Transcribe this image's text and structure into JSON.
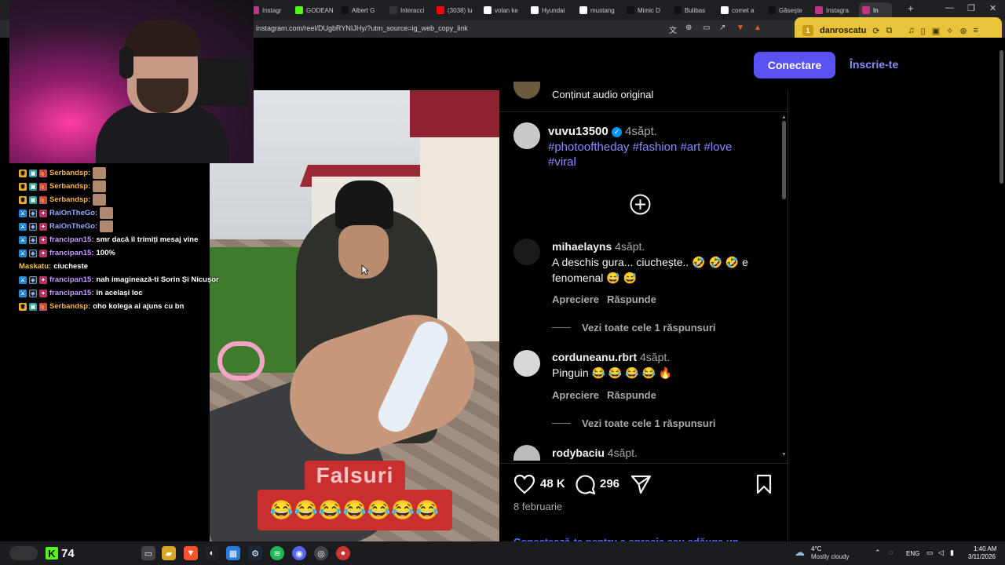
{
  "browser": {
    "tabs": [
      {
        "label": "Instagr",
        "fav": "ig",
        "color": "#c13584"
      },
      {
        "label": "GODEAN",
        "fav": "K",
        "color": "#53fc18"
      },
      {
        "label": "Albert G",
        "fav": "tiktok",
        "color": "#111111"
      },
      {
        "label": "Interacci",
        "fav": "diamond",
        "color": "#333333"
      },
      {
        "label": "(3038) lu",
        "fav": "yt",
        "color": "#ff0000"
      },
      {
        "label": "volan ke",
        "fav": "g",
        "color": "#ffffff"
      },
      {
        "label": "Hyundai",
        "fav": "h",
        "color": "#ffffff"
      },
      {
        "label": "mustang",
        "fav": "g",
        "color": "#ffffff"
      },
      {
        "label": "Mimic D",
        "fav": "tiktok",
        "color": "#111111"
      },
      {
        "label": "Bulibas",
        "fav": "tiktok",
        "color": "#111111"
      },
      {
        "label": "comet a",
        "fav": "g",
        "color": "#ffffff"
      },
      {
        "label": "Găseşte",
        "fav": "tiktok",
        "color": "#111111"
      },
      {
        "label": "Instagra",
        "fav": "ig",
        "color": "#c13584"
      },
      {
        "label": "In",
        "fav": "ig",
        "color": "#c13584"
      }
    ],
    "new_tab": "+",
    "minimize": "—",
    "maximize": "❐",
    "close": "✕",
    "url": "instagram.com/reel/DUgbRYNIJHy/?utm_source=ig_web_copy_link",
    "profile_badge": "1",
    "profile_name": "danroscatu"
  },
  "header": {
    "login": "Conectare",
    "signup": "Înscrie-te"
  },
  "chat": [
    {
      "badges": [
        "crown",
        "mod",
        "gift"
      ],
      "user": "Serbandsp:",
      "user_color": "orange",
      "msg": "",
      "emote": true
    },
    {
      "badges": [
        "crown",
        "mod",
        "gift"
      ],
      "user": "Serbandsp:",
      "user_color": "orange",
      "msg": "",
      "emote": true
    },
    {
      "badges": [
        "crown",
        "mod",
        "gift"
      ],
      "user": "Serbandsp:",
      "user_color": "orange",
      "msg": "",
      "emote": true
    },
    {
      "badges": [
        "sword",
        "sub",
        "pink"
      ],
      "user": "RaiOnTheGo:",
      "user_color": "blue",
      "msg": "",
      "emote": true
    },
    {
      "badges": [
        "sword",
        "sub",
        "pink"
      ],
      "user": "RaiOnTheGo:",
      "user_color": "blue",
      "msg": "",
      "emote": true
    },
    {
      "badges": [
        "sword",
        "sub",
        "pink"
      ],
      "user": "francipan15:",
      "user_color": "purple",
      "msg": "smr dacă îl trimiți mesaj vine",
      "emote": false
    },
    {
      "badges": [
        "sword",
        "sub",
        "pink"
      ],
      "user": "francipan15:",
      "user_color": "purple",
      "msg": "100%",
      "emote": false
    },
    {
      "badges": [],
      "user": "Maskatu:",
      "user_color": "yellow",
      "msg": "ciucheste",
      "emote": false
    },
    {
      "badges": [
        "sword",
        "sub",
        "pink"
      ],
      "user": "francipan15:",
      "user_color": "purple",
      "msg": "nah imaginează-ti Sorin Și Nicușor",
      "emote": false
    },
    {
      "badges": [
        "sword",
        "sub",
        "pink"
      ],
      "user": "francipan15:",
      "user_color": "purple",
      "msg": "în același loc",
      "emote": false
    },
    {
      "badges": [
        "crown",
        "mod",
        "gift"
      ],
      "user": "Serbandsp:",
      "user_color": "orange",
      "msg": "oho kolega ai ajuns cu bn",
      "emote": false
    }
  ],
  "video": {
    "caption": "Falsuri",
    "emojis": "😂😂😂😂😂😂😂"
  },
  "panel": {
    "audio": "Conținut audio original",
    "post": {
      "user": "vuvu13500",
      "time": "4săpt.",
      "hashtags_line1": "#photooftheday #fashion #art #love",
      "hashtags_line2": "#viral"
    },
    "comments": [
      {
        "user": "mihaelayns",
        "time": "4săpt.",
        "line1": "A deschis gura... ciuchește.. 🤣 🤣 🤣  e",
        "line2": "fenomenal 😅 😅",
        "like": "Apreciere",
        "reply": "Răspunde",
        "view_replies": "Vezi toate cele 1 răspunsuri"
      },
      {
        "user": "corduneanu.rbrt",
        "time": "4săpt.",
        "line1": "Pinguin 😂 😂 😂 😂 🔥",
        "line2": "",
        "like": "Apreciere",
        "reply": "Răspunde",
        "view_replies": "Vezi toate cele 1 răspunsuri"
      },
      {
        "user": "rodybaciu",
        "time": "4săpt.",
        "line1": "",
        "line2": ""
      }
    ],
    "likes": "48 K",
    "comments_count": "296",
    "date": "8 februarie",
    "bottom_link": "Conectează-te pentru a aprecia sau adăuga un"
  },
  "taskbar": {
    "count": "74",
    "weather_temp": "4°C",
    "weather_desc": "Mostly cloudy",
    "lang": "ENG",
    "time": "1:40 AM",
    "date": "3/11/2026"
  }
}
